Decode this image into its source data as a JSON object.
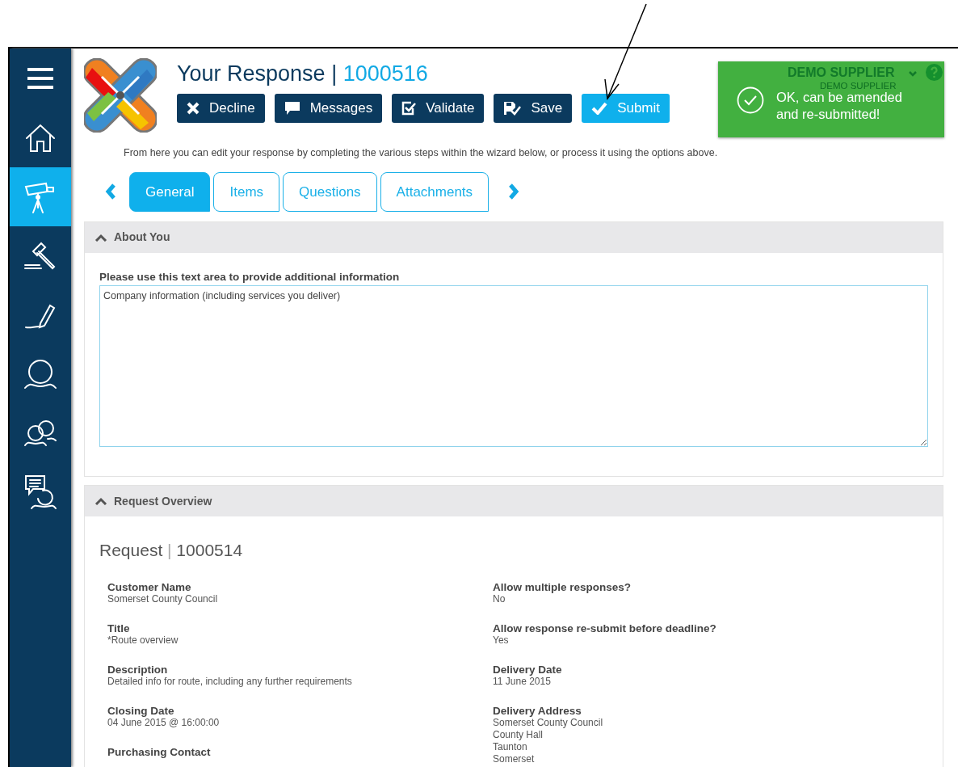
{
  "sidebar": {
    "items": [
      {
        "kind": "menu",
        "selected": false
      },
      {
        "kind": "home",
        "selected": false
      },
      {
        "kind": "telescope",
        "selected": true
      },
      {
        "kind": "gavel",
        "selected": false
      },
      {
        "kind": "pencil",
        "selected": false
      },
      {
        "kind": "person",
        "selected": false
      },
      {
        "kind": "people",
        "selected": false
      },
      {
        "kind": "chat",
        "selected": false
      }
    ]
  },
  "header": {
    "title": "Your Response",
    "separator": "|",
    "number": "1000516",
    "buttons": [
      {
        "label": "Decline",
        "kind": "decline",
        "highlighted": false
      },
      {
        "label": "Messages",
        "kind": "messages",
        "highlighted": false
      },
      {
        "label": "Validate",
        "kind": "validate",
        "highlighted": false
      },
      {
        "label": "Save",
        "kind": "save",
        "highlighted": false
      },
      {
        "label": "Submit",
        "kind": "submit",
        "highlighted": true
      }
    ]
  },
  "notification": {
    "user": "DEMO SUPPLIER",
    "organisation": "DEMO SUPPLIER",
    "message": "OK, can be amended and re-submitted!"
  },
  "intro": "From here you can edit your response by completing the various steps within the wizard below, or process it using the options above.",
  "tabs": [
    {
      "label": "General",
      "selected": true
    },
    {
      "label": "Items",
      "selected": false
    },
    {
      "label": "Questions",
      "selected": false
    },
    {
      "label": "Attachments",
      "selected": false
    }
  ],
  "about": {
    "title": "About You",
    "expanded": true,
    "field_label": "Please use this text area to provide additional information",
    "value": "Company information (including services you deliver)"
  },
  "overview": {
    "title": "Request Overview",
    "expanded": true,
    "heading": "Request",
    "separator": "|",
    "number": "1000514",
    "left": [
      {
        "label": "Customer Name",
        "lines": [
          "Somerset County Council"
        ]
      },
      {
        "label": "Title",
        "lines": [
          "*Route overview"
        ]
      },
      {
        "label": "Description",
        "lines": [
          "Detailed info for route, including any further requirements"
        ]
      },
      {
        "label": "Closing Date",
        "lines": [
          "04 June 2015 @ 16:00:00"
        ]
      },
      {
        "label": "Purchasing Contact"
      }
    ],
    "right": [
      {
        "label": "Allow multiple responses?",
        "lines": [
          "No"
        ]
      },
      {
        "label": "Allow response re-submit before deadline?",
        "lines": [
          "Yes"
        ]
      },
      {
        "label": "Delivery Date",
        "lines": [
          "11 June 2015"
        ]
      },
      {
        "label": "Delivery Address",
        "lines": [
          "Somerset County Council",
          "County Hall",
          "Taunton",
          "Somerset"
        ]
      }
    ]
  }
}
